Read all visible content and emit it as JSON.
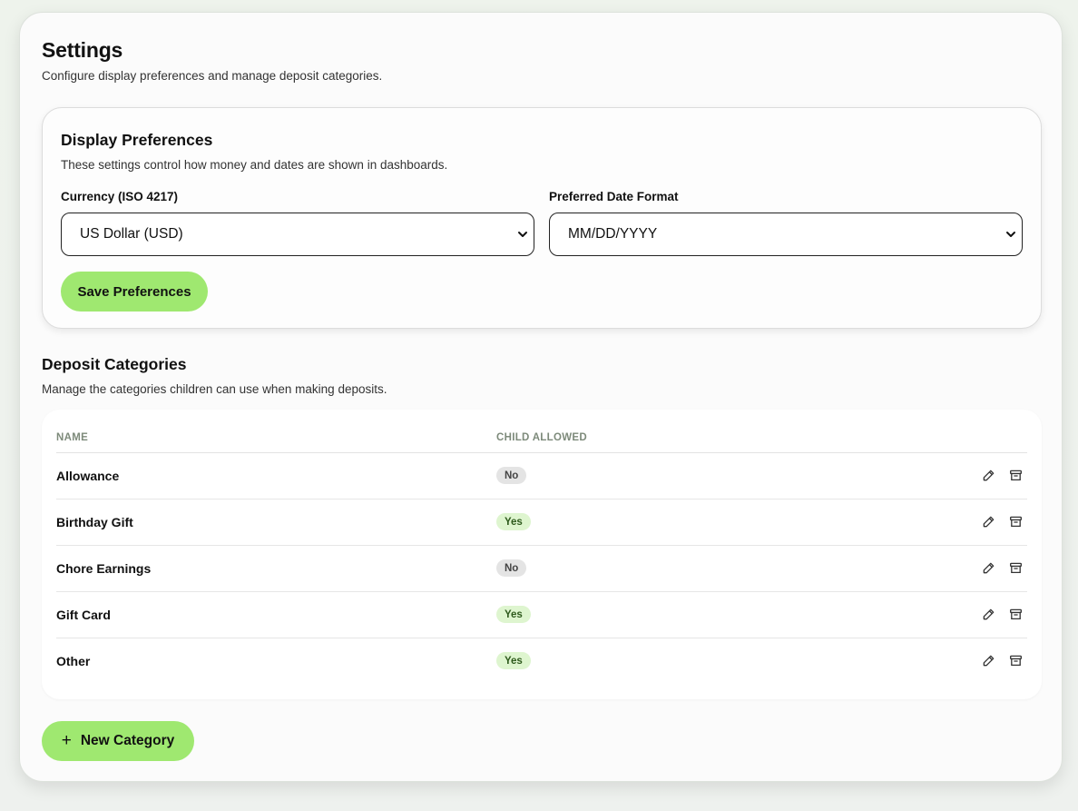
{
  "page": {
    "title": "Settings",
    "subtitle": "Configure display preferences and manage deposit categories."
  },
  "display_preferences": {
    "title": "Display Preferences",
    "description": "These settings control how money and dates are shown in dashboards.",
    "currency": {
      "label": "Currency (ISO 4217)",
      "selected": "US Dollar (USD)"
    },
    "date_format": {
      "label": "Preferred Date Format",
      "selected": "MM/DD/YYYY"
    },
    "save_label": "Save Preferences"
  },
  "deposit_categories": {
    "title": "Deposit Categories",
    "description": "Manage the categories children can use when making deposits.",
    "columns": [
      "NAME",
      "CHILD ALLOWED"
    ],
    "rows": [
      {
        "name": "Allowance",
        "child_allowed": "No",
        "allowed": false
      },
      {
        "name": "Birthday Gift",
        "child_allowed": "Yes",
        "allowed": true
      },
      {
        "name": "Chore Earnings",
        "child_allowed": "No",
        "allowed": false
      },
      {
        "name": "Gift Card",
        "child_allowed": "Yes",
        "allowed": true
      },
      {
        "name": "Other",
        "child_allowed": "Yes",
        "allowed": true
      }
    ],
    "row_actions": [
      "pencil-icon",
      "archive-icon"
    ],
    "new_label": "New Category",
    "new_icon": "plus-icon"
  },
  "colors": {
    "accent": "#9fe870",
    "badge_yes_bg": "#def5cf",
    "badge_no_bg": "#e4e4e4"
  }
}
